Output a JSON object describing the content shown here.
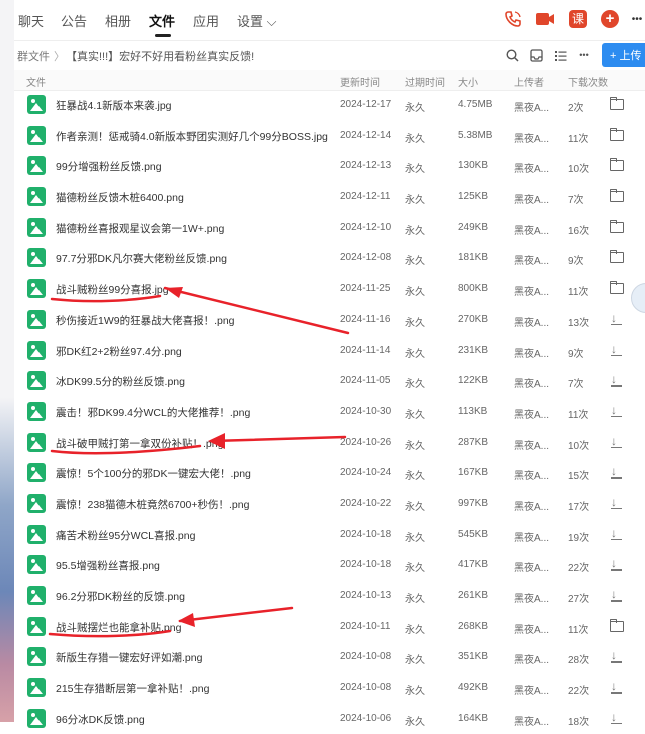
{
  "tabs": [
    {
      "label": "聊天"
    },
    {
      "label": "公告"
    },
    {
      "label": "相册"
    },
    {
      "label": "文件"
    },
    {
      "label": "应用"
    },
    {
      "label": "设置 ⌵"
    }
  ],
  "top_icons": {
    "phone": "phone-icon",
    "video": "video-icon",
    "class_label": "课",
    "add": "plus-circle-icon",
    "more": "•••"
  },
  "breadcrumb": {
    "root": "群文件",
    "sep": "〉",
    "current": "【真实!!!】宏好不好用看粉丝真实反馈!"
  },
  "toolbar": {
    "more": "•••",
    "upload_label": "+ 上传"
  },
  "columns": {
    "name": "文件",
    "date": "更新时间",
    "expire": "过期时间",
    "size": "大小",
    "uploader": "上传者",
    "downloads": "下载次数"
  },
  "files": [
    {
      "name": "狂暴战4.1新版本来袭.jpg",
      "date": "2024-12-17",
      "expire": "永久",
      "size": "4.75MB",
      "uploader": "黑夜A...",
      "downloads": "2次",
      "action": "folder"
    },
    {
      "name": "作者亲测！惩戒骑4.0新版本野团实测好几个99分BOSS.jpg",
      "date": "2024-12-14",
      "expire": "永久",
      "size": "5.38MB",
      "uploader": "黑夜A...",
      "downloads": "11次",
      "action": "folder"
    },
    {
      "name": "99分增强粉丝反馈.png",
      "date": "2024-12-13",
      "expire": "永久",
      "size": "130KB",
      "uploader": "黑夜A...",
      "downloads": "10次",
      "action": "folder"
    },
    {
      "name": "猫德粉丝反馈木桩6400.png",
      "date": "2024-12-11",
      "expire": "永久",
      "size": "125KB",
      "uploader": "黑夜A...",
      "downloads": "7次",
      "action": "folder"
    },
    {
      "name": "猫德粉丝喜报观星议会第一1W+.png",
      "date": "2024-12-10",
      "expire": "永久",
      "size": "249KB",
      "uploader": "黑夜A...",
      "downloads": "16次",
      "action": "folder"
    },
    {
      "name": "97.7分邪DK凡尔赛大佬粉丝反馈.png",
      "date": "2024-12-08",
      "expire": "永久",
      "size": "181KB",
      "uploader": "黑夜A...",
      "downloads": "9次",
      "action": "folder"
    },
    {
      "name": "战斗贼粉丝99分喜报.jpg",
      "date": "2024-11-25",
      "expire": "永久",
      "size": "800KB",
      "uploader": "黑夜A...",
      "downloads": "11次",
      "action": "folder"
    },
    {
      "name": "秒伤接近1W9的狂暴战大佬喜报！.png",
      "date": "2024-11-16",
      "expire": "永久",
      "size": "270KB",
      "uploader": "黑夜A...",
      "downloads": "13次",
      "action": "download"
    },
    {
      "name": "邪DK红2+2粉丝97.4分.png",
      "date": "2024-11-14",
      "expire": "永久",
      "size": "231KB",
      "uploader": "黑夜A...",
      "downloads": "9次",
      "action": "download"
    },
    {
      "name": "冰DK99.5分的粉丝反馈.png",
      "date": "2024-11-05",
      "expire": "永久",
      "size": "122KB",
      "uploader": "黑夜A...",
      "downloads": "7次",
      "action": "download"
    },
    {
      "name": "震击！邪DK99.4分WCL的大佬推荐！.png",
      "date": "2024-10-30",
      "expire": "永久",
      "size": "113KB",
      "uploader": "黑夜A...",
      "downloads": "11次",
      "action": "download"
    },
    {
      "name": "战斗破甲贼打第一拿双份补贴！.png",
      "date": "2024-10-26",
      "expire": "永久",
      "size": "287KB",
      "uploader": "黑夜A...",
      "downloads": "10次",
      "action": "download"
    },
    {
      "name": "震惊！5个100分的邪DK一键宏大佬！.png",
      "date": "2024-10-24",
      "expire": "永久",
      "size": "167KB",
      "uploader": "黑夜A...",
      "downloads": "15次",
      "action": "download"
    },
    {
      "name": "震惊！238猫德木桩竟然6700+秒伤！.png",
      "date": "2024-10-22",
      "expire": "永久",
      "size": "997KB",
      "uploader": "黑夜A...",
      "downloads": "17次",
      "action": "download"
    },
    {
      "name": "痛苦术粉丝95分WCL喜报.png",
      "date": "2024-10-18",
      "expire": "永久",
      "size": "545KB",
      "uploader": "黑夜A...",
      "downloads": "19次",
      "action": "download"
    },
    {
      "name": "95.5增强粉丝喜报.png",
      "date": "2024-10-18",
      "expire": "永久",
      "size": "417KB",
      "uploader": "黑夜A...",
      "downloads": "22次",
      "action": "download"
    },
    {
      "name": "96.2分邪DK粉丝的反馈.png",
      "date": "2024-10-13",
      "expire": "永久",
      "size": "261KB",
      "uploader": "黑夜A...",
      "downloads": "27次",
      "action": "download"
    },
    {
      "name": "战斗贼摆烂也能拿补贴.png",
      "date": "2024-10-11",
      "expire": "永久",
      "size": "268KB",
      "uploader": "黑夜A...",
      "downloads": "11次",
      "action": "folder"
    },
    {
      "name": "新版生存猎一键宏好评如潮.png",
      "date": "2024-10-08",
      "expire": "永久",
      "size": "351KB",
      "uploader": "黑夜A...",
      "downloads": "28次",
      "action": "download"
    },
    {
      "name": "215生存猎断层第一拿补贴！.png",
      "date": "2024-10-08",
      "expire": "永久",
      "size": "492KB",
      "uploader": "黑夜A...",
      "downloads": "22次",
      "action": "download"
    },
    {
      "name": "96分冰DK反馈.png",
      "date": "2024-10-06",
      "expire": "永久",
      "size": "164KB",
      "uploader": "黑夜A...",
      "downloads": "18次",
      "action": "download"
    }
  ],
  "colors": {
    "accent_blue": "#2d8cf0",
    "icon_red": "#e0462b",
    "file_icon_green": "#20b06b",
    "annotation_red": "#e8222a"
  }
}
